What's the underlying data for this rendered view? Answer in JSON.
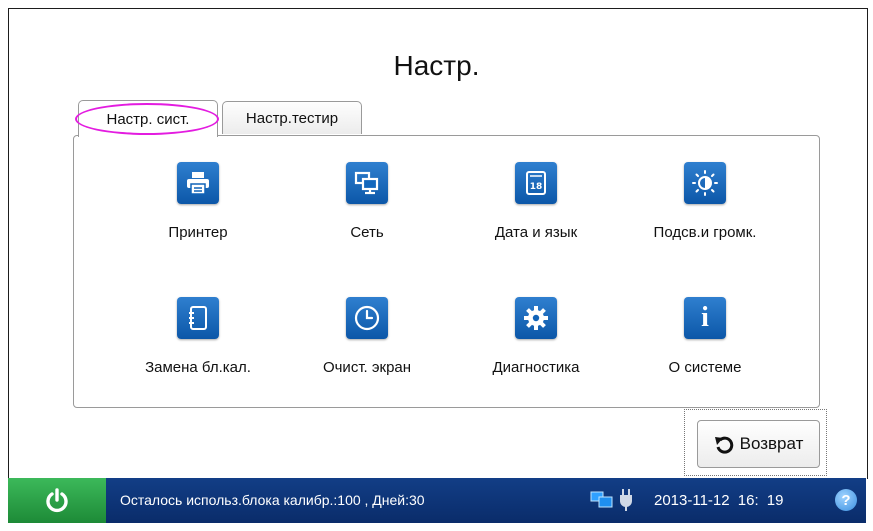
{
  "header": {
    "title": "Настр."
  },
  "tabs": [
    {
      "label": "Настр. сист."
    },
    {
      "label": "Настр.тестир"
    }
  ],
  "tiles": [
    {
      "label": "Принтер",
      "icon": "printer-icon"
    },
    {
      "label": "Сеть",
      "icon": "network-icon"
    },
    {
      "label": "Дата и язык",
      "icon": "calendar-icon",
      "icon_text": "18"
    },
    {
      "label": "Подсв.и громк.",
      "icon": "brightness-icon"
    },
    {
      "label": "Замена бл.кал.",
      "icon": "notebook-icon"
    },
    {
      "label": "Очист. экран",
      "icon": "clock-icon"
    },
    {
      "label": "Диагностика",
      "icon": "gear-icon"
    },
    {
      "label": "О системе",
      "icon": "info-icon",
      "icon_text": "i"
    }
  ],
  "return_button": {
    "label": "Возврат",
    "icon": "return-arrow-icon"
  },
  "statusbar": {
    "message": "Осталось использ.блока калибр.:100 , Дней:30",
    "datetime": "2013-11-12 16: 19",
    "help": "?"
  },
  "colors": {
    "accent": "#0c57a8",
    "statusbar": "#0a2c6a",
    "power": "#1d8a37",
    "highlight": "#e31ce0"
  }
}
